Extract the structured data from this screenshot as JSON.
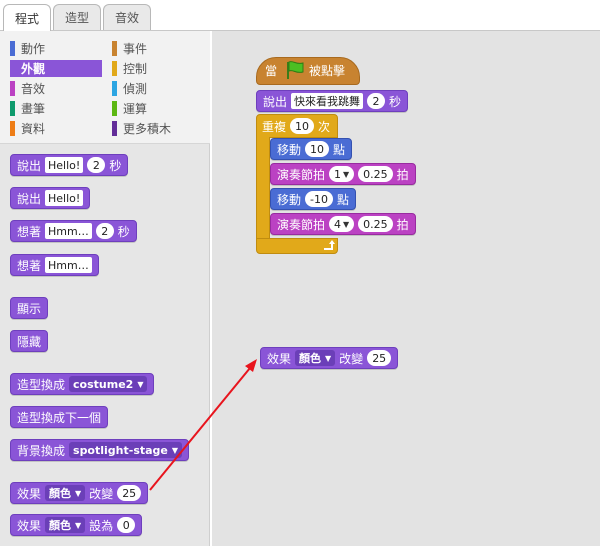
{
  "tabs": [
    {
      "label": "程式"
    },
    {
      "label": "造型"
    },
    {
      "label": "音效"
    }
  ],
  "categories": [
    {
      "label": "動作",
      "color": "#4a6cd4"
    },
    {
      "label": "外觀",
      "color": "#8a55d7"
    },
    {
      "label": "音效",
      "color": "#bb42c3"
    },
    {
      "label": "畫筆",
      "color": "#0e9a6c"
    },
    {
      "label": "資料",
      "color": "#ee7d16"
    },
    {
      "label": "事件",
      "color": "#c88330"
    },
    {
      "label": "控制",
      "color": "#e1a91a"
    },
    {
      "label": "偵測",
      "color": "#2ca5e2"
    },
    {
      "label": "運算",
      "color": "#5cb712"
    },
    {
      "label": "更多積木",
      "color": "#632d99"
    }
  ],
  "palette": {
    "say_for_label": "說出",
    "say_for_text": "Hello!",
    "say_for_secs": "2",
    "say_for_unit": "秒",
    "say_label": "說出",
    "say_text": "Hello!",
    "think_for_label": "想著",
    "think_for_text": "Hmm…",
    "think_for_secs": "2",
    "think_for_unit": "秒",
    "think_label": "想著",
    "think_text": "Hmm…",
    "show": "顯示",
    "hide": "隱藏",
    "switch_costume_label": "造型換成",
    "switch_costume_value": "costume2",
    "next_costume": "造型換成下一個",
    "switch_backdrop_label": "背景換成",
    "switch_backdrop_value": "spotlight-stage",
    "change_effect_label": "效果",
    "change_effect_value": "顏色",
    "change_effect_by": "改變",
    "change_effect_num": "25",
    "set_effect_label": "效果",
    "set_effect_value": "顏色",
    "set_effect_to": "設為",
    "set_effect_num": "0"
  },
  "script": {
    "hat_when": "當",
    "hat_clicked": "被點擊",
    "say_label": "說出",
    "say_text": "快來看我跳舞",
    "say_secs": "2",
    "say_unit": "秒",
    "repeat_label": "重複",
    "repeat_num": "10",
    "repeat_unit": "次",
    "move1_label": "移動",
    "move1_num": "10",
    "move1_unit": "點",
    "play1_label": "演奏節拍",
    "play1_drum": "1",
    "play1_beats": "0.25",
    "play1_unit": "拍",
    "move2_label": "移動",
    "move2_num": "-10",
    "move2_unit": "點",
    "play2_label": "演奏節拍",
    "play2_drum": "4",
    "play2_beats": "0.25",
    "play2_unit": "拍",
    "loose_label": "效果",
    "loose_value": "顏色",
    "loose_by": "改變",
    "loose_num": "25"
  },
  "annotation": {
    "arrow_color": "#e8141d"
  }
}
